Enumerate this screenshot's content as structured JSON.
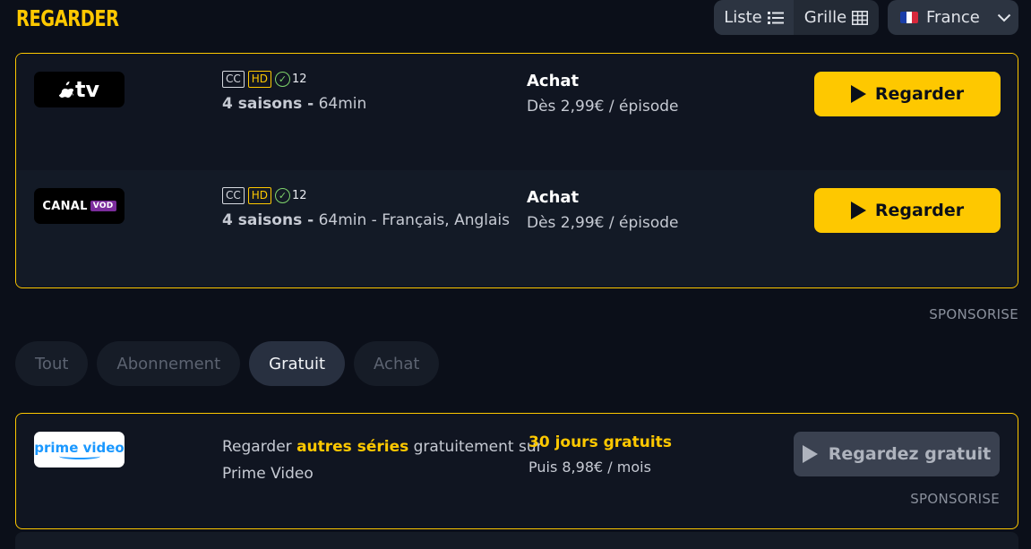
{
  "header": {
    "title": "REGARDER",
    "view_options": [
      {
        "label": "Liste",
        "icon": "list-icon"
      },
      {
        "label": "Grille",
        "icon": "grid-icon"
      }
    ],
    "country": {
      "label": "France",
      "flag": "france-flag-icon"
    }
  },
  "offers": [
    {
      "provider": "Apple TV",
      "logo_text": "tv",
      "badges": [
        "CC",
        "HD"
      ],
      "age_rating": "12",
      "seasons": "4 saisons -",
      "runtime": "64min",
      "languages": "",
      "type": "Achat",
      "price": "Dès 2,99€ / épisode",
      "button": "Regarder"
    },
    {
      "provider": "Canal VOD",
      "logo_text": "CANAL",
      "logo_sub": "VOD",
      "badges": [
        "CC",
        "HD"
      ],
      "age_rating": "12",
      "seasons": "4 saisons -",
      "runtime": "64min",
      "languages": " - Français, Anglais",
      "type": "Achat",
      "price": "Dès 2,99€ / épisode",
      "button": "Regarder"
    }
  ],
  "sponsor_label": "SPONSORISE",
  "filters": [
    {
      "label": "Tout",
      "active": false
    },
    {
      "label": "Abonnement",
      "active": false
    },
    {
      "label": "Gratuit",
      "active": true
    },
    {
      "label": "Achat",
      "active": false
    }
  ],
  "sponsored": {
    "provider": "Prime Video",
    "logo_text": "prime video",
    "text_before": "Regarder ",
    "highlight": "autres séries",
    "text_after": " gratuitement sur",
    "text_line2": "Prime Video",
    "promo": "30 jours gratuits",
    "price": "Puis 8,98€ / mois",
    "button": "Regardez gratuit",
    "sponsor_label": "SPONSORISE"
  },
  "colors": {
    "accent": "#fec800",
    "background": "#0b0f19",
    "flag": [
      "#1a3ea8",
      "#ffffff",
      "#d8283b"
    ]
  }
}
